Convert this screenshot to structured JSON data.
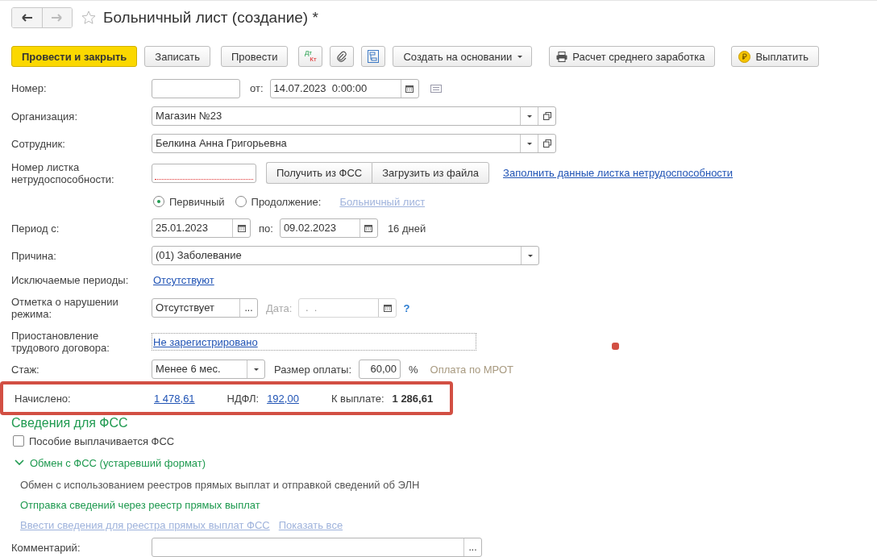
{
  "window": {
    "title": "Больничный лист (создание) *"
  },
  "nav": [
    {
      "kind": "back",
      "disabled": false
    },
    {
      "kind": "forward",
      "disabled": true
    }
  ],
  "favorite": {
    "on": false
  },
  "toolbar": [
    {
      "kind": "button",
      "label": "Провести и закрыть",
      "default": true
    },
    {
      "kind": "button",
      "label": "Записать",
      "default": false
    },
    {
      "kind": "button",
      "label": "Провести",
      "default": false
    },
    {
      "kind": "dtkt",
      "top": "Дт",
      "bottom": "Кт"
    },
    {
      "kind": "attach"
    },
    {
      "kind": "structure"
    },
    {
      "kind": "menu",
      "label": "Создать на основании"
    },
    {
      "kind": "print",
      "label": "Расчет среднего заработка"
    },
    {
      "kind": "pay",
      "label": "Выплатить"
    }
  ],
  "number": {
    "label": "Номер:",
    "date_label": "от:",
    "date": "14.07.2023  0:00:00"
  },
  "organization": {
    "label": "Организация:",
    "value": "Магазин №23"
  },
  "employee": {
    "label": "Сотрудник:",
    "value": "Белкина Анна Григорьевна"
  },
  "sick_leave": {
    "label": "Номер листка нетрудоспособности:",
    "required": true,
    "buttons": [
      "Получить из ФСС",
      "Загрузить из файла"
    ],
    "link": "Заполнить данные листка нетрудоспособности"
  },
  "type_options": [
    {
      "label": "Первичный",
      "selected": true
    },
    {
      "label": "Продолжение:",
      "selected": false
    }
  ],
  "continuation_link": {
    "text": "Больничный лист",
    "disabled": true
  },
  "period": {
    "label": "Период с:",
    "from": "25.01.2023",
    "to_label": "по:",
    "to": "09.02.2023",
    "days": "16 дней"
  },
  "reason": {
    "label": "Причина:",
    "value": "(01) Заболевание"
  },
  "excluded": {
    "label": "Исключаемые периоды:",
    "link": "Отсутствуют"
  },
  "violation": {
    "label": "Отметка о нарушении режима:",
    "value": "Отсутствует",
    "choice": "...",
    "date_label": "Дата:",
    "date": " .  .",
    "date_disabled": true,
    "help": "?"
  },
  "suspension": {
    "label": "Приостановление трудового договора:",
    "link": "Не зарегистрировано"
  },
  "experience": {
    "label": "Стаж:",
    "value": "Менее 6 мес.",
    "pay_label": "Размер оплаты:",
    "pay_value": "60,00",
    "pay_unit": "%",
    "note": "Оплата по МРОТ"
  },
  "totals": {
    "highlighted": true,
    "accrued_label": "Начислено:",
    "accrued": "1 478,61",
    "ndfl_label": "НДФЛ:",
    "ndfl": "192,00",
    "payable_label": "К выплате:",
    "payable": "1 286,61"
  },
  "annotation_dot": true,
  "fss": {
    "title": "Сведения для ФСС",
    "checkbox": {
      "label": "Пособие выплачивается ФСС",
      "checked": false
    },
    "group": {
      "title": "Обмен с ФСС (устаревший формат)",
      "expanded": true,
      "description": "Обмен с использованием реестров прямых выплат и отправкой сведений об ЭЛН",
      "subtitle": "Отправка сведений через реестр прямых выплат",
      "links": [
        {
          "text": "Ввести сведения для реестра прямых выплат ФСС",
          "disabled": true
        },
        {
          "text": "Показать все",
          "disabled": true
        }
      ]
    }
  },
  "comment": {
    "label": "Комментарий:",
    "choice": "..."
  }
}
